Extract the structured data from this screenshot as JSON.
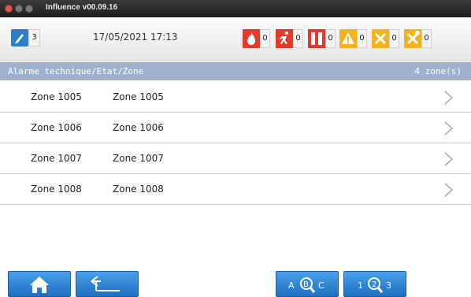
{
  "window": {
    "title": "Influence v00.09.16"
  },
  "statusbar": {
    "user_count": "3",
    "datetime": "17/05/2021  17:13",
    "alarms": [
      {
        "icon": "fire-icon",
        "count": "0",
        "color": "#e23a2b"
      },
      {
        "icon": "evacuation-icon",
        "count": "0",
        "color": "#e23a2b"
      },
      {
        "icon": "door-icon",
        "count": "0",
        "color": "#e23a2b"
      },
      {
        "icon": "warning-icon",
        "count": "0",
        "color": "#f3b11e"
      },
      {
        "icon": "fault-icon",
        "count": "0",
        "color": "#f3b11e"
      },
      {
        "icon": "disabled-icon",
        "count": "0",
        "color": "#f3b11e"
      }
    ]
  },
  "header": {
    "title": "Alarme technique/Etat/Zone",
    "count": "4 zone(s)"
  },
  "zones": [
    {
      "id": "Zone 1005",
      "name": "Zone 1005"
    },
    {
      "id": "Zone 1006",
      "name": "Zone 1006"
    },
    {
      "id": "Zone 1007",
      "name": "Zone 1007"
    },
    {
      "id": "Zone 1008",
      "name": "Zone 1008"
    }
  ],
  "toolbar": {
    "buttons": [
      {
        "icon": "home-icon"
      },
      {
        "icon": "back-arrow-icon"
      },
      {
        "icon": "search-alpha-icon",
        "label": "ABC"
      },
      {
        "icon": "search-numeric-icon",
        "label": "123"
      }
    ]
  },
  "colors": {
    "header_bg": "#9eb1cd",
    "button_blue": "#2a86d8",
    "user_blue": "#2f7fc8"
  }
}
